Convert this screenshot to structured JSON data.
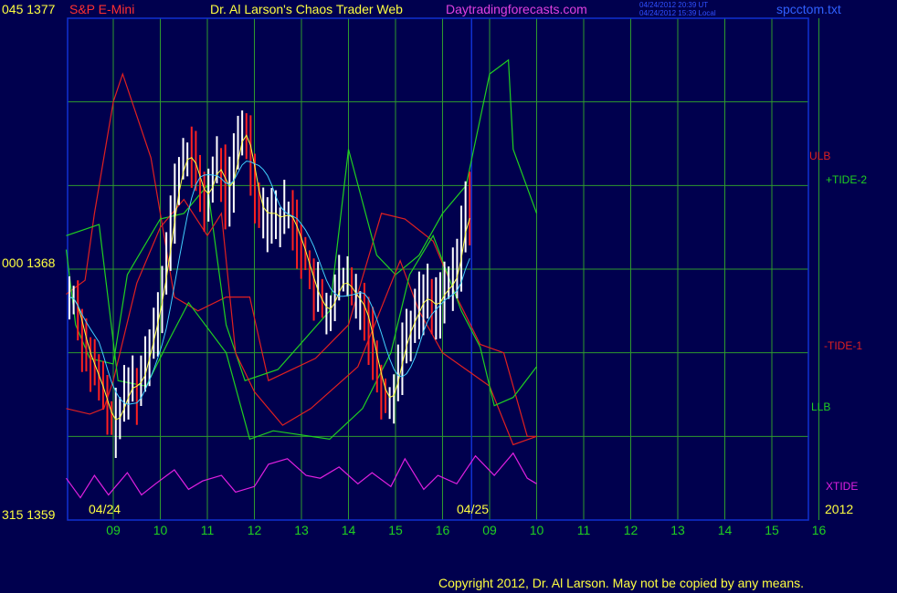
{
  "header": {
    "price_hi": "045 1377",
    "symbol": "S&P E-Mini",
    "title": "Dr. Al Larson's Chaos Trader Web",
    "site": "Daytradingforecasts.com",
    "time_ut": "04/24/2012 20:39 UT",
    "time_local": "04/24/2012 15:39 Local",
    "file": "spcctom.txt"
  },
  "y_labels": {
    "top": "045 1377",
    "mid": "000 1368",
    "bottom": "315 1359"
  },
  "date_labels": {
    "day1": "04/24",
    "day2": "04/25",
    "year": "2012"
  },
  "legend": {
    "ulb": "ULB",
    "tide2": "+TIDE-2",
    "tide1": "-TIDE-1",
    "llb": "LLB",
    "xtide": "XTIDE"
  },
  "footer": "Copyright 2012, Dr. Al Larson.  May not be copied by any means.",
  "colors": {
    "background": "#00004e",
    "grid": "#2e9a2e",
    "ulb": "#e02020",
    "tide2": "#20d020",
    "tide1": "#e02020",
    "xtide": "#e020e0",
    "price": "#ffffff",
    "down": "#ff2020",
    "ma_yellow": "#ffff40",
    "ma_cyan": "#40d0ff",
    "axis": "#1030d0"
  },
  "chart_data": {
    "type": "line",
    "title": "S&P E-Mini",
    "y_axis": {
      "prices": [
        1359,
        1368,
        1377
      ],
      "angles": [
        "315",
        "000",
        "045"
      ]
    },
    "x_ticks": [
      "09",
      "10",
      "11",
      "12",
      "13",
      "14",
      "15",
      "16",
      "09",
      "10",
      "11",
      "12",
      "13",
      "14",
      "15",
      "16"
    ],
    "dates": [
      "04/24",
      "04/25"
    ],
    "grid": true,
    "price_range_estimate": {
      "low": 1362.0,
      "high": 1373.5,
      "last": 1369.6
    },
    "price_close": [
      1367,
      1366.9,
      1366.2,
      1365.4,
      1365,
      1364.6,
      1364.2,
      1363.8,
      1363.4,
      1362.8,
      1362.4,
      1362.6,
      1363,
      1363.4,
      1363.8,
      1364,
      1363.6,
      1364.2,
      1364.8,
      1365.4,
      1366,
      1366.8,
      1367.6,
      1368.6,
      1369.8,
      1370.8,
      1371.6,
      1372,
      1372.2,
      1371.8,
      1371.4,
      1370.8,
      1370.4,
      1370.9,
      1371.5,
      1371.8,
      1371.4,
      1370.6,
      1370.9,
      1371.9,
      1372.7,
      1373.1,
      1372.6,
      1371.6,
      1370.8,
      1370.1,
      1369.8,
      1370.2,
      1370,
      1369.8,
      1369.8,
      1370.1,
      1369.9,
      1369.6,
      1369.1,
      1368.7,
      1368.3,
      1367.6,
      1367.2,
      1366.9,
      1366.6,
      1366.4,
      1366.7,
      1367.3,
      1367.5,
      1367.6,
      1367.4,
      1367.1,
      1366.9,
      1366.8,
      1366.4,
      1365.7,
      1364.9,
      1364.2,
      1363.7,
      1363.2,
      1363.3,
      1363.9,
      1364.6,
      1365.3,
      1365.8,
      1366.1,
      1366.4,
      1366.8,
      1367.1,
      1366.9,
      1366.6,
      1366.7,
      1367.1,
      1367.4,
      1367.3,
      1367.6,
      1368.2,
      1369.3,
      1370.4,
      1369.8
    ],
    "series": [
      {
        "name": "ULB",
        "points": [
          [
            0,
            1367.1
          ],
          [
            0.4,
            1367.6
          ],
          [
            0.6,
            1370
          ],
          [
            1,
            1374
          ],
          [
            1.2,
            1375
          ],
          [
            1.8,
            1372
          ],
          [
            2.3,
            1367
          ],
          [
            2.8,
            1366.5
          ],
          [
            3.4,
            1367
          ],
          [
            3.9,
            1367
          ],
          [
            4.3,
            1364
          ],
          [
            5.3,
            1364.8
          ],
          [
            6,
            1366
          ],
          [
            6.7,
            1370
          ],
          [
            7.2,
            1369.8
          ],
          [
            7.8,
            1369
          ],
          [
            8.3,
            1367
          ],
          [
            8.8,
            1365.3
          ],
          [
            9.3,
            1365
          ],
          [
            9.8,
            1362
          ],
          [
            10,
            1362
          ]
        ]
      },
      {
        "name": "+TIDE-2",
        "points": [
          [
            0,
            1368.7
          ],
          [
            0.2,
            1366
          ],
          [
            0.5,
            1364.8
          ],
          [
            1,
            1364.6
          ],
          [
            1.3,
            1367.8
          ],
          [
            2,
            1369.8
          ],
          [
            2.5,
            1370
          ],
          [
            3,
            1371
          ],
          [
            3.4,
            1366
          ],
          [
            3.8,
            1364
          ],
          [
            4.5,
            1364.4
          ],
          [
            5.6,
            1366.5
          ],
          [
            6,
            1372.3
          ],
          [
            6.6,
            1368.5
          ],
          [
            7,
            1367.8
          ],
          [
            7.5,
            1368.5
          ],
          [
            8,
            1370
          ],
          [
            8.5,
            1371
          ],
          [
            9,
            1375
          ],
          [
            9.4,
            1375.5
          ],
          [
            9.5,
            1372.3
          ],
          [
            10,
            1370
          ]
        ]
      },
      {
        "name": "-TIDE-1",
        "points": [
          [
            0,
            1363
          ],
          [
            0.5,
            1362.8
          ],
          [
            0.8,
            1363
          ],
          [
            1,
            1364
          ],
          [
            1.5,
            1367.5
          ],
          [
            2,
            1369.5
          ],
          [
            2.5,
            1370.5
          ],
          [
            3,
            1369.2
          ],
          [
            3.3,
            1370
          ],
          [
            3.6,
            1365
          ],
          [
            4,
            1363.6
          ],
          [
            4.6,
            1362.4
          ],
          [
            5.2,
            1363
          ],
          [
            6.2,
            1364.5
          ],
          [
            7.1,
            1368.3
          ],
          [
            7.5,
            1366.5
          ],
          [
            8,
            1365
          ],
          [
            9,
            1363.8
          ],
          [
            9.5,
            1361.7
          ],
          [
            10,
            1362
          ]
        ]
      },
      {
        "name": "LLB",
        "points": [
          [
            0,
            1369.2
          ],
          [
            0.7,
            1369.6
          ],
          [
            1.1,
            1364
          ],
          [
            1.7,
            1363.8
          ],
          [
            2.2,
            1365.5
          ],
          [
            2.6,
            1366.8
          ],
          [
            3.4,
            1365
          ],
          [
            3.9,
            1361.9
          ],
          [
            4.4,
            1362.2
          ],
          [
            5.6,
            1361.9
          ],
          [
            6.3,
            1363
          ],
          [
            6.9,
            1365
          ],
          [
            7.3,
            1367.8
          ],
          [
            7.8,
            1369.2
          ],
          [
            8.4,
            1366.5
          ],
          [
            8.8,
            1365.2
          ],
          [
            9.1,
            1363.1
          ],
          [
            9.5,
            1363.4
          ],
          [
            10,
            1364.5
          ]
        ]
      },
      {
        "name": "XTIDE",
        "points": [
          [
            0,
            1360.5
          ],
          [
            0.3,
            1359.8
          ],
          [
            0.6,
            1360.6
          ],
          [
            0.9,
            1359.9
          ],
          [
            1.3,
            1360.7
          ],
          [
            1.6,
            1359.9
          ],
          [
            1.9,
            1360.3
          ],
          [
            2.3,
            1360.8
          ],
          [
            2.6,
            1360.1
          ],
          [
            2.9,
            1360.4
          ],
          [
            3.3,
            1360.6
          ],
          [
            3.6,
            1360
          ],
          [
            4,
            1360.2
          ],
          [
            4.3,
            1361
          ],
          [
            4.7,
            1361.2
          ],
          [
            5.1,
            1360.6
          ],
          [
            5.4,
            1360.5
          ],
          [
            5.8,
            1360.9
          ],
          [
            6.2,
            1360.3
          ],
          [
            6.5,
            1360.7
          ],
          [
            6.9,
            1360.2
          ],
          [
            7.2,
            1361.2
          ],
          [
            7.6,
            1360.1
          ],
          [
            7.9,
            1360.6
          ],
          [
            8.3,
            1360.3
          ],
          [
            8.7,
            1361.3
          ],
          [
            9.1,
            1360.6
          ],
          [
            9.5,
            1361.4
          ],
          [
            9.8,
            1360.5
          ],
          [
            10,
            1360.3
          ]
        ]
      }
    ]
  }
}
